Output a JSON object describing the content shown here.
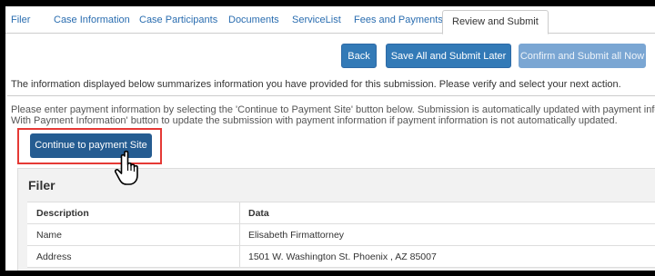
{
  "tabs": [
    {
      "label": "Filer"
    },
    {
      "label": "Case Information"
    },
    {
      "label": "Case Participants"
    },
    {
      "label": "Documents"
    },
    {
      "label": "ServiceList"
    },
    {
      "label": "Fees and Payments"
    },
    {
      "label": "Review and Submit",
      "active": true
    }
  ],
  "actions": {
    "back": "Back",
    "save_later": "Save All and Submit Later",
    "confirm": "Confirm and Submit all Now"
  },
  "summary_text": "The information displayed below summarizes information you have provided for this submission. Please verify and select your next action.",
  "instructions": {
    "line1": "Please enter payment information by selecting the 'Continue to Payment Site' button below. Submission is automatically updated with payment information af",
    "line2": "With Payment Information' button to update the submission with payment information if payment information is not automatically updated."
  },
  "pay_button": "Continue to payment Site",
  "filer": {
    "title": "Filer",
    "columns": [
      "Description",
      "Data"
    ],
    "rows": [
      {
        "description": "Name",
        "data": "Elisabeth Firmattorney"
      },
      {
        "description": "Address",
        "data": "1501 W. Washington St. Phoenix , AZ 85007"
      }
    ]
  },
  "colors": {
    "link": "#2a6db0",
    "primary_button": "#337ab7",
    "disabled_button": "#7aa6d3",
    "highlight": "#e53935"
  },
  "icons": {
    "pointer": "hand-pointer-icon"
  }
}
